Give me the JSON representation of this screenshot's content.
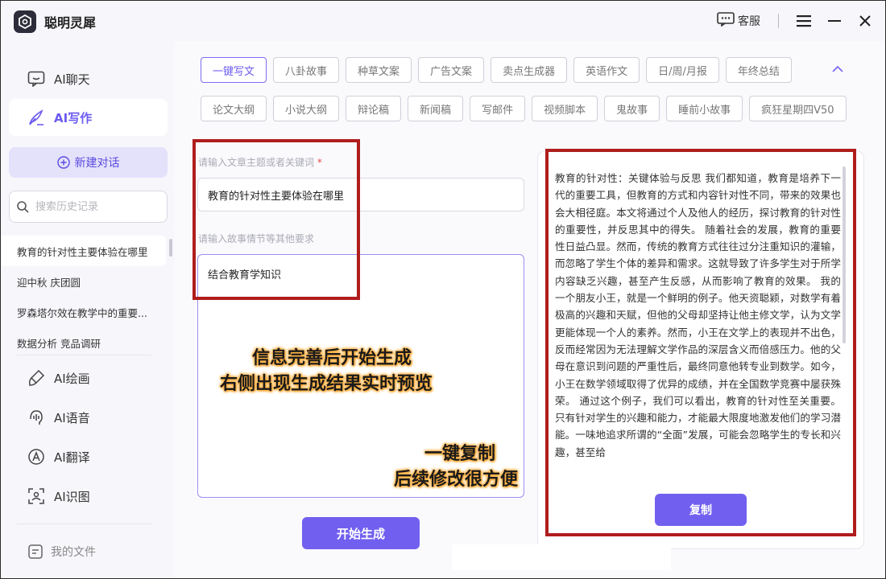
{
  "app": {
    "title": "聪明灵犀"
  },
  "titlebar": {
    "support_label": "客服"
  },
  "sidebar": {
    "nav": [
      {
        "label": "AI聊天",
        "icon": "chat-icon"
      },
      {
        "label": "AI写作",
        "icon": "pen-icon"
      }
    ],
    "new_chat_label": "新建对话",
    "search_placeholder": "搜索历史记录",
    "history": [
      "教育的针对性主要体验在哪里",
      "迎中秋 庆团圆",
      "罗森塔尔效在教学中的重要...",
      "数据分析 竞品调研"
    ],
    "tools": [
      {
        "label": "AI绘画",
        "icon": "paint-icon"
      },
      {
        "label": "AI语音",
        "icon": "voice-icon"
      },
      {
        "label": "AI翻译",
        "icon": "translate-icon"
      },
      {
        "label": "AI识图",
        "icon": "scan-icon"
      }
    ],
    "files_label": "我的文件"
  },
  "tags": {
    "row1": [
      "一键写文",
      "八卦故事",
      "种草文案",
      "广告文案",
      "卖点生成器",
      "英语作文",
      "日/周/月报",
      "年终总结"
    ],
    "row2": [
      "论文大纲",
      "小说大纲",
      "辩论稿",
      "新闻稿",
      "写邮件",
      "视频脚本",
      "鬼故事",
      "睡前小故事",
      "疯狂星期四V50"
    ],
    "active": "一键写文"
  },
  "form": {
    "topic_label": "请输入文章主题或者关键词",
    "topic_required": "*",
    "topic_value": "教育的针对性主要体验在哪里",
    "details_label": "请输入故事情节等其他要求",
    "details_value": "结合教育学知识",
    "generate_label": "开始生成"
  },
  "captions": {
    "line1": "信息完善后开始生成",
    "line2": "右侧出现生成结果实时预览",
    "line3": "一键复制",
    "line4": "后续修改很方便"
  },
  "preview": {
    "text": "教育的针对性：关键体验与反思 我们都知道，教育是培养下一代的重要工具，但教育的方式和内容针对性不同，带来的效果也会大相径庭。本文将通过个人及他人的经历，探讨教育的针对性的重要性，并反思其中的得失。 随着社会的发展，教育的重要性日益凸显。然而，传统的教育方式往往过分注重知识的灌输，而忽略了学生个体的差异和需求。这就导致了许多学生对于所学内容缺乏兴趣，甚至产生反感，从而影响了教育的效果。 我的一个朋友小王，就是一个鲜明的例子。他天资聪颖，对数学有着极高的兴趣和天赋，但他的父母却坚持让他主修文学，认为文学更能体现一个人的素养。然而，小王在文学上的表现并不出色，反而经常因为无法理解文学作品的深层含义而倍感压力。他的父母在意识到问题的严重性后，最终同意他转专业到数学。如今，小王在数学领域取得了优异的成绩，并在全国数学竞赛中屡获殊荣。 通过这个例子，我们可以看出，教育的针对性至关重要。只有针对学生的兴趣和能力，才能最大限度地激发他们的学习潜能。一味地追求所谓的“全面”发展，可能会忽略学生的专长和兴趣，甚至给",
    "copy_label": "复制"
  },
  "colors": {
    "accent": "#7160ef",
    "annotation_red": "#b01d1d"
  }
}
